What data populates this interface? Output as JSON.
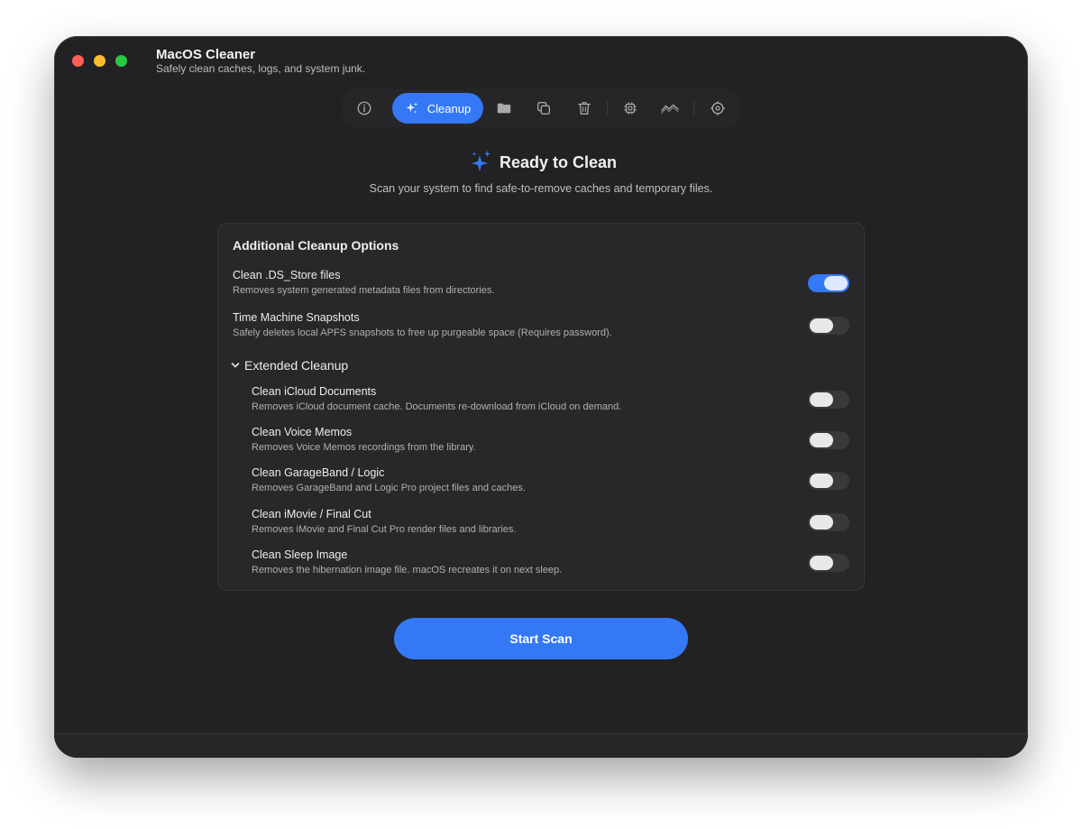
{
  "app": {
    "title": "MacOS Cleaner",
    "subtitle": "Safely clean caches, logs, and system junk."
  },
  "toolbar": {
    "active_label": "Cleanup",
    "items": [
      "info-icon",
      "sparkles-icon",
      "folder-icon",
      "duplicate-icon",
      "trash-icon",
      "cpu-icon",
      "activity-icon",
      "settings-icon"
    ]
  },
  "hero": {
    "title": "Ready to Clean",
    "subtitle": "Scan your system to find safe-to-remove caches and temporary files."
  },
  "panel": {
    "title": "Additional Cleanup Options",
    "options": [
      {
        "title": "Clean .DS_Store files",
        "desc": "Removes system generated metadata files from directories.",
        "enabled": true
      },
      {
        "title": "Time Machine Snapshots",
        "desc": "Safely deletes local APFS snapshots to free up purgeable space (Requires password).",
        "enabled": false
      }
    ],
    "extended": {
      "label": "Extended Cleanup",
      "expanded": true,
      "options": [
        {
          "title": "Clean iCloud Documents",
          "desc": "Removes iCloud document cache. Documents re-download from iCloud on demand.",
          "enabled": false
        },
        {
          "title": "Clean Voice Memos",
          "desc": "Removes Voice Memos recordings from the library.",
          "enabled": false
        },
        {
          "title": "Clean GarageBand / Logic",
          "desc": "Removes GarageBand and Logic Pro project files and caches.",
          "enabled": false
        },
        {
          "title": "Clean iMovie / Final Cut",
          "desc": "Removes iMovie and Final Cut Pro render files and libraries.",
          "enabled": false
        },
        {
          "title": "Clean Sleep Image",
          "desc": "Removes the hibernation image file. macOS recreates it on next sleep.",
          "enabled": false
        }
      ]
    }
  },
  "action": {
    "scan_label": "Start Scan"
  },
  "colors": {
    "accent": "#3478f6",
    "window_bg": "#222224",
    "close": "#fe5f57",
    "minimize": "#febc2e",
    "zoom": "#28c840"
  }
}
